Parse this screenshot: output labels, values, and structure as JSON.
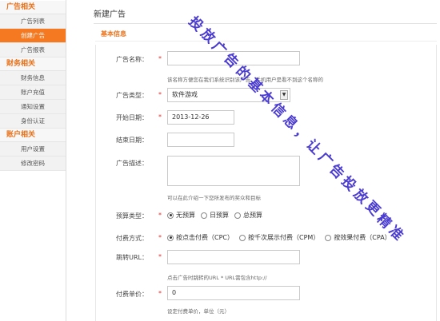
{
  "sidebar": {
    "sections": [
      {
        "title": "广告相关",
        "items": [
          "广告列表",
          "创建广告",
          "广告报表"
        ],
        "active": 1
      },
      {
        "title": "财务相关",
        "items": [
          "财务信息",
          "账户充值",
          "通知设置",
          "身份认证"
        ],
        "active": -1
      },
      {
        "title": "账户相关",
        "items": [
          "用户设置",
          "修改密码"
        ],
        "active": -1
      }
    ]
  },
  "page": {
    "title": "新建广告",
    "section": "基本信息"
  },
  "form": {
    "name_label": "广告名称：",
    "name_value": "",
    "name_hint": "该名称方便您在我们系统识别该广告，手机用户是看不到这个名称的",
    "type_label": "广告类型：",
    "type_value": "软件游戏",
    "start_label": "开始日期：",
    "start_value": "2013-12-26",
    "end_label": "结束日期：",
    "end_value": "",
    "desc_label": "广告描述：",
    "desc_hint": "可以在此介绍一下您所发布的奖众和目标",
    "budget_label": "预算类型：",
    "budget_options": [
      "无预算",
      "日预算",
      "总预算"
    ],
    "budget_selected": 0,
    "pay_label": "付费方式：",
    "pay_options": [
      "按点击付费（CPC）",
      "按千次展示付费（CPM）",
      "按效果付费（CPA）"
    ],
    "pay_selected": 0,
    "url_label": "跳转URL：",
    "url_value": "",
    "url_hint": "点击广告时跳转的URL * URL需包含http://",
    "price_label": "付费单价：",
    "price_value": "0",
    "price_hint": "设定付费单价，单位（元）",
    "required_mark": "*"
  },
  "watermark": {
    "text": "投放广告的基本信息，让广告投放更精准",
    "color": "#4a3bd1"
  },
  "colors": {
    "accent": "#f47920",
    "section_title": "#e8711a",
    "required": "#e03030"
  }
}
